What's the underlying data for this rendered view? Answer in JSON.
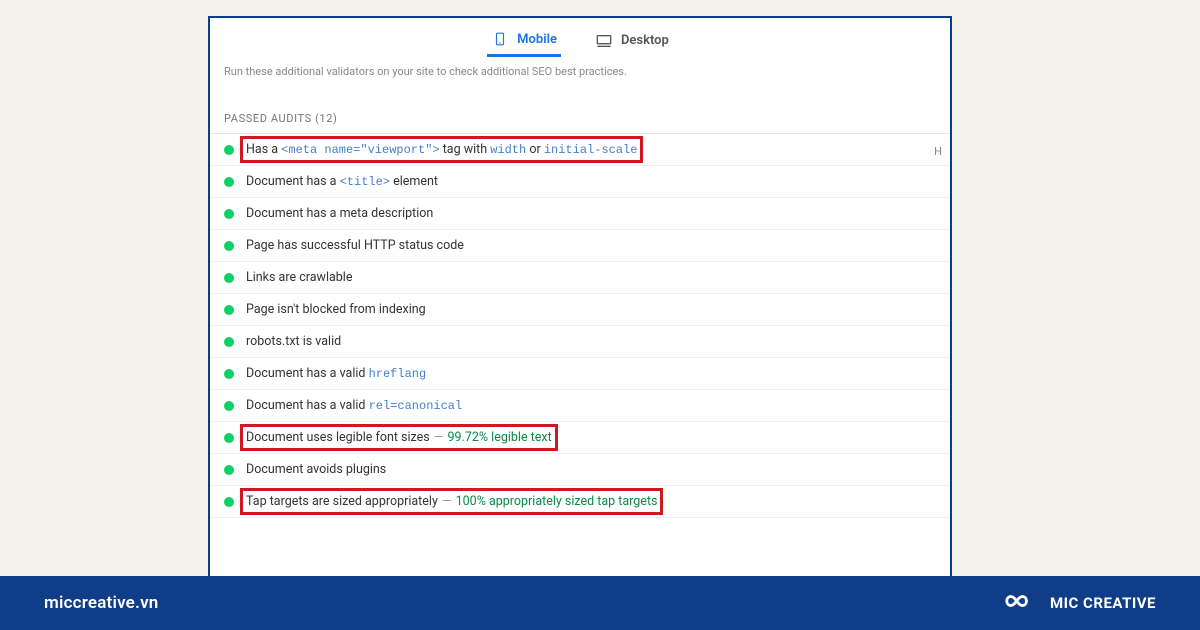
{
  "tabs": {
    "mobile": "Mobile",
    "desktop": "Desktop"
  },
  "hint": "Run these additional validators on your site to check additional SEO best practices.",
  "section": {
    "title": "PASSED AUDITS",
    "count": "(12)"
  },
  "marker": "H",
  "audits": [
    {
      "boxed": true,
      "parts": [
        {
          "t": "Has a "
        },
        {
          "t": "<meta name=\"viewport\">",
          "code": true
        },
        {
          "t": " tag with "
        },
        {
          "t": "width",
          "code": true
        },
        {
          "t": " or "
        },
        {
          "t": "initial-scale",
          "code": true
        }
      ]
    },
    {
      "parts": [
        {
          "t": "Document has a "
        },
        {
          "t": "<title>",
          "code": true
        },
        {
          "t": " element"
        }
      ]
    },
    {
      "parts": [
        {
          "t": "Document has a meta description"
        }
      ]
    },
    {
      "parts": [
        {
          "t": "Page has successful HTTP status code"
        }
      ]
    },
    {
      "parts": [
        {
          "t": "Links are crawlable"
        }
      ]
    },
    {
      "parts": [
        {
          "t": "Page isn't blocked from indexing"
        }
      ]
    },
    {
      "parts": [
        {
          "t": "robots.txt is valid"
        }
      ]
    },
    {
      "parts": [
        {
          "t": "Document has a valid "
        },
        {
          "t": "hreflang",
          "code": true
        }
      ]
    },
    {
      "parts": [
        {
          "t": "Document has a valid "
        },
        {
          "t": "rel=canonical",
          "code": true
        }
      ]
    },
    {
      "boxed": true,
      "parts": [
        {
          "t": "Document uses legible font sizes"
        },
        {
          "t": "—",
          "sep": true
        },
        {
          "t": "99.72% legible text",
          "metric": true
        }
      ]
    },
    {
      "parts": [
        {
          "t": "Document avoids plugins"
        }
      ]
    },
    {
      "boxed": true,
      "parts": [
        {
          "t": "Tap targets are sized appropriately"
        },
        {
          "t": "—",
          "sep": true
        },
        {
          "t": "100% appropriately sized tap targets",
          "metric": true
        }
      ]
    }
  ],
  "footer": {
    "site": "miccreative.vn",
    "brand": "MIC CREATIVE"
  }
}
